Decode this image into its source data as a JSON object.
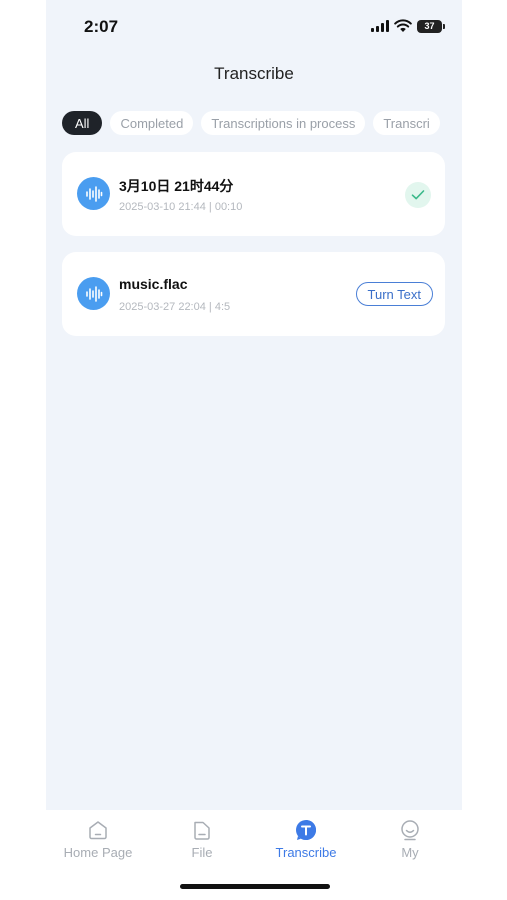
{
  "status_bar": {
    "time": "2:07",
    "battery": "37"
  },
  "header": {
    "title": "Transcribe"
  },
  "filters": [
    {
      "label": "All",
      "active": true
    },
    {
      "label": "Completed",
      "active": false
    },
    {
      "label": "Transcriptions in process",
      "active": false
    },
    {
      "label": "Transcri",
      "active": false
    }
  ],
  "items": [
    {
      "title": "3月10日 21时44分",
      "date": "2025-03-10 21:44",
      "duration": "00:10",
      "meta": "2025-03-10 21:44 | 00:10",
      "status": "completed",
      "icon": "check-icon"
    },
    {
      "title": "music.flac",
      "date": "2025-03-27 22:04",
      "duration": "4:5",
      "meta": "2025-03-27 22:04 | 4:5",
      "status": "pending",
      "action_label": "Turn Text"
    }
  ],
  "nav": [
    {
      "label": "Home Page",
      "icon": "home-icon",
      "active": false
    },
    {
      "label": "File",
      "icon": "file-icon",
      "active": false
    },
    {
      "label": "Transcribe",
      "icon": "transcribe-icon",
      "active": true
    },
    {
      "label": "My",
      "icon": "profile-icon",
      "active": false
    }
  ],
  "colors": {
    "accent": "#3d7ae6",
    "avatar": "#4a9df0",
    "success": "#3bb98a",
    "background": "#f0f4fa"
  }
}
